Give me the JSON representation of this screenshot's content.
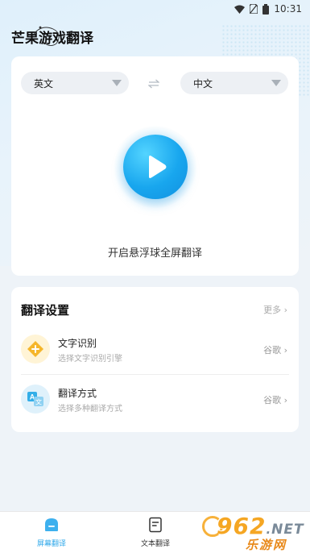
{
  "status_bar": {
    "time": "10:31"
  },
  "app": {
    "title": "芒果游戏翻译"
  },
  "translate_card": {
    "source_language": "英文",
    "target_language": "中文",
    "float_caption": "开启悬浮球全屏翻译"
  },
  "settings": {
    "title": "翻译设置",
    "more_label": "更多 ›",
    "items": [
      {
        "title": "文字识别",
        "subtitle": "选择文字识别引擎",
        "value": "谷歌 ›",
        "icon": "ocr-engine-icon"
      },
      {
        "title": "翻译方式",
        "subtitle": "选择多种翻译方式",
        "value": "谷歌 ›",
        "icon": "translate-mode-icon"
      }
    ]
  },
  "bottom_nav": {
    "tabs": [
      {
        "label": "屏幕翻译",
        "active": true,
        "icon": "screen-translate-icon"
      },
      {
        "label": "文本翻译",
        "active": false,
        "icon": "text-translate-icon"
      }
    ]
  },
  "watermark": {
    "number": "962",
    "suffix": "NET",
    "subtitle": "乐游网"
  },
  "colors": {
    "accent": "#2fa8ea",
    "play_button": "#18a6ee",
    "ocr_icon": "#f5b62b"
  }
}
